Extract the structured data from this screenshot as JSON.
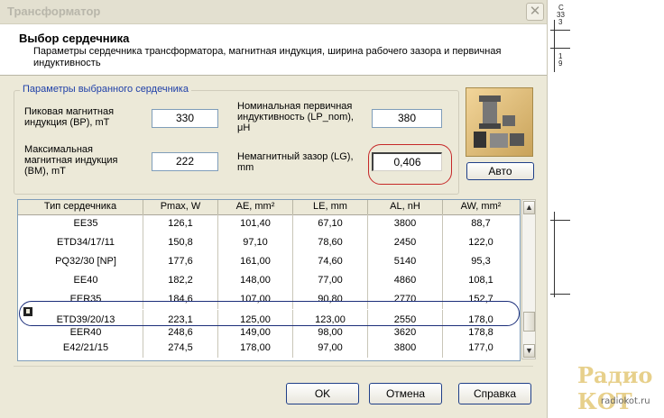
{
  "window": {
    "title": "Трансформатор",
    "close_glyph": "✕"
  },
  "header": {
    "title": "Выбор сердечника",
    "description": "Параметры сердечника трансформатора, магнитная индукция, ширина рабочего зазора и первичная индуктивность"
  },
  "group": {
    "title": "Параметры выбранного сердечника",
    "bp_label": "Пиковая магнитная индукция (BP), mT",
    "bp_value": "330",
    "bm_label": "Максимальная магнитная индукция (BM), mT",
    "bm_value": "222",
    "lp_label": "Номинальная первичная индуктивность (LP_nom), μH",
    "lp_value": "380",
    "lg_label": "Немагнитный зазор (LG), mm",
    "lg_value": "0,406"
  },
  "auto_button": "Авто",
  "table": {
    "columns": [
      "Тип сердечника",
      "Pmax, W",
      "AE, mm²",
      "LE, mm",
      "AL, nH",
      "AW, mm²"
    ],
    "rows": [
      [
        "EE35",
        "126,1",
        "101,40",
        "67,10",
        "3800",
        "88,7"
      ],
      [
        "ETD34/17/11",
        "150,8",
        "97,10",
        "78,60",
        "2450",
        "122,0"
      ],
      [
        "PQ32/30 [NP]",
        "177,6",
        "161,00",
        "74,60",
        "5140",
        "95,3"
      ],
      [
        "EE40",
        "182,2",
        "148,00",
        "77,00",
        "4860",
        "108,1"
      ],
      [
        "EER35",
        "184,6",
        "107,00",
        "90,80",
        "2770",
        "152,7"
      ],
      [
        "ETD39/20/13",
        "223,1",
        "125,00",
        "123,00",
        "2550",
        "178,0"
      ],
      [
        "EER40",
        "248,6",
        "149,00",
        "98,00",
        "3620",
        "178,8"
      ],
      [
        "E42/21/15",
        "274,5",
        "178,00",
        "97,00",
        "3800",
        "177,0"
      ]
    ],
    "selected_index": 5
  },
  "buttons": {
    "ok": "OK",
    "cancel": "Отмена",
    "help": "Справка"
  },
  "side_sketch": {
    "t1": "С",
    "t2": "33",
    "t3": "3",
    "t4": "1",
    "t5": "9"
  },
  "watermark": {
    "line1": "Радио КОТ",
    "line2": "radiokot.ru"
  }
}
